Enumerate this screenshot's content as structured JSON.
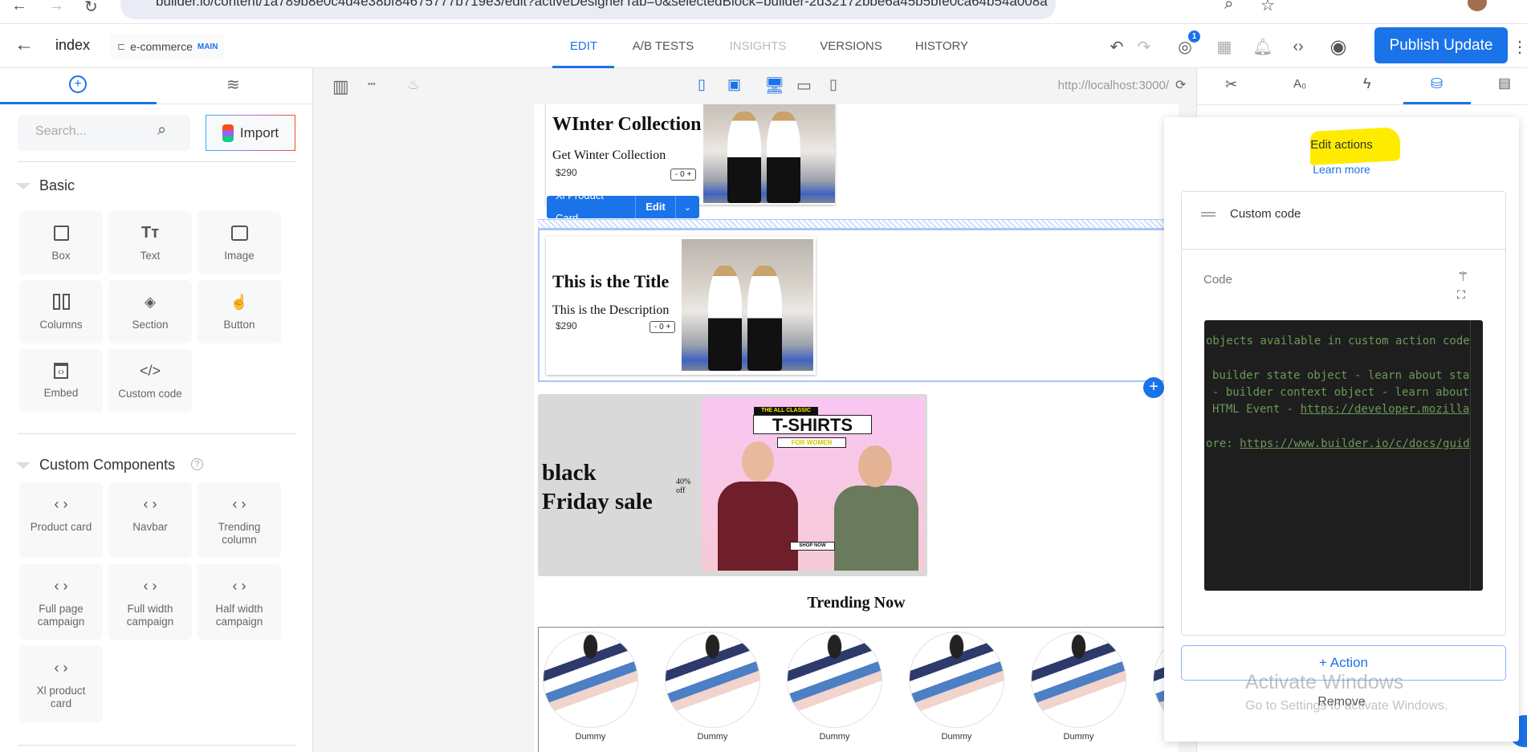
{
  "browser": {
    "url": "builder.io/content/1a789b8e0c4d4e38bf84675777b719e3/edit?activeDesignerTab=0&selectedBlock=builder-2d32172bbe6a45b5bfe0ca64b54a008a"
  },
  "header": {
    "title": "index",
    "space": "e-commerce",
    "branch": "MAIN",
    "tabs": [
      {
        "label": "EDIT",
        "active": true
      },
      {
        "label": "A/B TESTS"
      },
      {
        "label": "INSIGHTS",
        "disabled": true
      },
      {
        "label": "VERSIONS"
      },
      {
        "label": "HISTORY"
      }
    ],
    "badge_count": "1",
    "publish_label": "Publish Update"
  },
  "left": {
    "search_placeholder": "Search...",
    "import_label": "Import",
    "basic_title": "Basic",
    "basic": [
      {
        "label": "Box",
        "icon": "box-icon"
      },
      {
        "label": "Text",
        "icon": "text-icon"
      },
      {
        "label": "Image",
        "icon": "image-icon"
      },
      {
        "label": "Columns",
        "icon": "columns-icon"
      },
      {
        "label": "Section",
        "icon": "section-icon"
      },
      {
        "label": "Button",
        "icon": "button-icon"
      },
      {
        "label": "Embed",
        "icon": "embed-icon"
      },
      {
        "label": "Custom code",
        "icon": "code-icon"
      }
    ],
    "custom_title": "Custom Components",
    "custom": [
      {
        "label": "Product card"
      },
      {
        "label": "Navbar"
      },
      {
        "label": "Trending column"
      },
      {
        "label": "Full page campaign"
      },
      {
        "label": "Full width campaign"
      },
      {
        "label": "Half width campaign"
      },
      {
        "label": "Xl product card"
      }
    ]
  },
  "canvas": {
    "url": "http://localhost:3000/",
    "card1": {
      "title": "WInter Collection",
      "desc": "Get Winter Collection",
      "price": "$290",
      "qty": "- 0 +"
    },
    "block_toolbar": {
      "name": "Xl Product Card",
      "edit": "Edit"
    },
    "card2": {
      "title": "This is the Title",
      "desc": "This is the Description",
      "price": "$290",
      "qty": "- 0 +"
    },
    "banner": {
      "line1": "black",
      "line2": "Friday sale",
      "discount1": "40%",
      "discount2": "off",
      "img_top": "THE ALL CLASSIC",
      "img_title": "T-SHIRTS",
      "img_sub": "FOR WOMEN",
      "img_cta": "SHOP NOW"
    },
    "trending_title": "Trending Now",
    "trending": [
      "Dummy",
      "Dummy",
      "Dummy",
      "Dummy",
      "Dummy"
    ]
  },
  "actions": {
    "title": "Edit actions",
    "learn_more": "Learn more",
    "action_name": "Custom code",
    "code_label": "Code",
    "code_lines": [
      "objects available in custom action code",
      "",
      "builder state object - learn about sta",
      "- builder context object - learn about",
      "HTML Event - ",
      "",
      "ore: "
    ],
    "link1": "https://developer.mozilla",
    "link2": "https://www.builder.io/c/docs/guid",
    "add_action": "+ Action",
    "remove": "Remove",
    "highlight_color": "#ffeb00"
  },
  "watermark": {
    "line1": "Activate Windows",
    "line2": "Go to Settings to activate Windows."
  },
  "colors": {
    "accent": "#1a73e8"
  }
}
